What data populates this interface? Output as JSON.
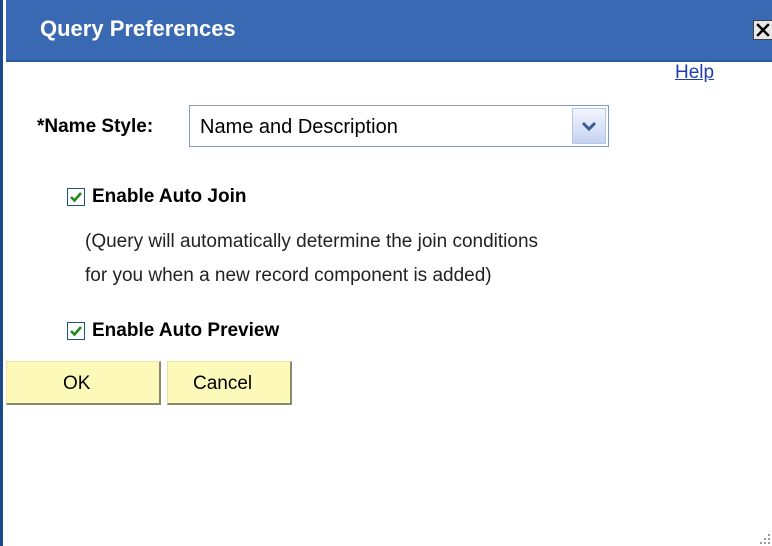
{
  "dialog": {
    "title": "Query Preferences",
    "close_icon": "close-icon",
    "help_label": "Help"
  },
  "form": {
    "name_style_label": "*Name Style:",
    "name_style_value": "Name and Description",
    "enable_auto_join": {
      "label": "Enable Auto Join",
      "checked": true,
      "note_line1": "(Query will automatically determine the join conditions",
      "note_line2": "for you when a new record component is added)"
    },
    "enable_auto_preview": {
      "label": "Enable Auto Preview",
      "checked": true
    }
  },
  "buttons": {
    "ok_label": "OK",
    "cancel_label": "Cancel"
  },
  "colors": {
    "titlebar": "#3a69b4",
    "button_face": "#fdf9b9",
    "link": "#1f3fb0",
    "checkmark": "#1d8a1d"
  }
}
